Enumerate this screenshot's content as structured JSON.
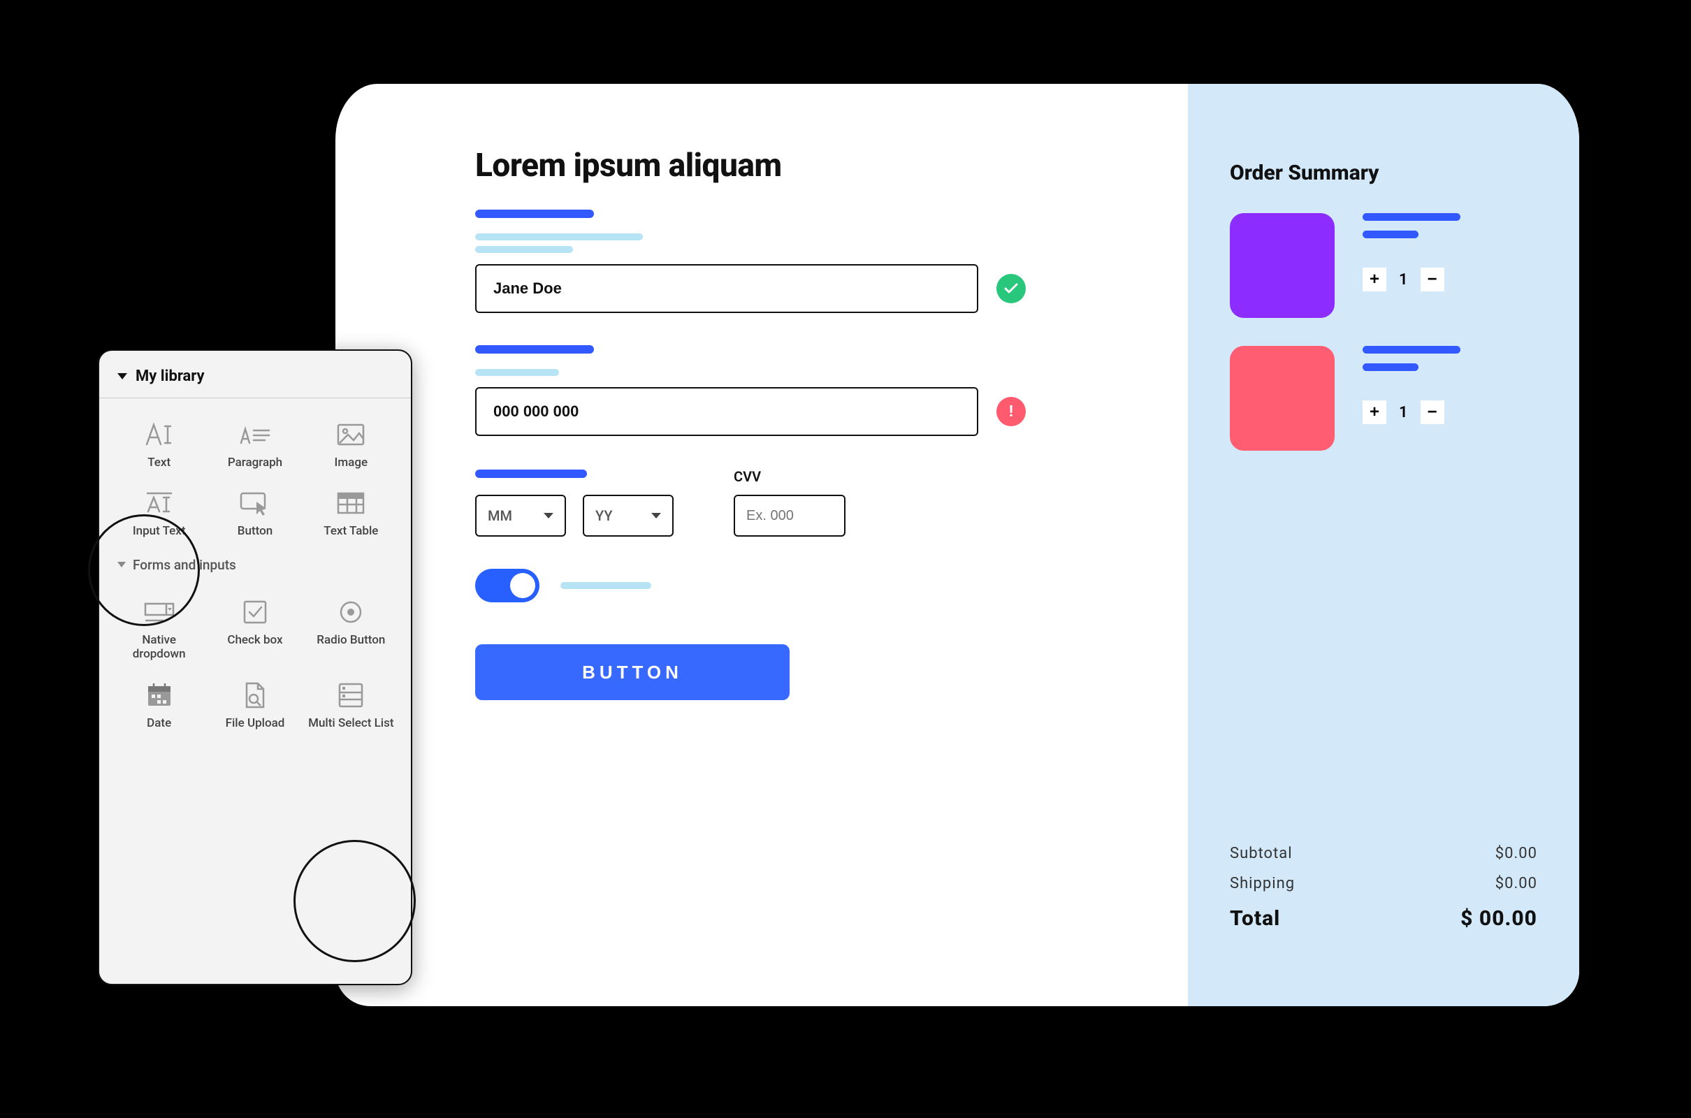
{
  "library": {
    "header": "My library",
    "items_row1": [
      {
        "label": "Text"
      },
      {
        "label": "Paragraph"
      },
      {
        "label": "Image"
      }
    ],
    "items_row2": [
      {
        "label": "Input Text"
      },
      {
        "label": "Button"
      },
      {
        "label": "Text Table"
      }
    ],
    "section2_title": "Forms and inputs",
    "items_row3": [
      {
        "label": "Native dropdown"
      },
      {
        "label": "Check box"
      },
      {
        "label": "Radio Button"
      }
    ],
    "items_row4": [
      {
        "label": "Date"
      },
      {
        "label": "File Upload"
      },
      {
        "label": "Multi Select List"
      }
    ]
  },
  "form": {
    "title": "Lorem ipsum aliquam",
    "name_value": "Jane Doe",
    "phone_value": "000 000 000",
    "exp_month_placeholder": "MM",
    "exp_year_placeholder": "YY",
    "cvv_label": "CVV",
    "cvv_placeholder": "Ex. 000",
    "submit_label": "BUTTON"
  },
  "summary": {
    "title": "Order Summary",
    "items": [
      {
        "color": "#8c2cff",
        "qty": "1"
      },
      {
        "color": "#ff5d72",
        "qty": "1"
      }
    ],
    "subtotal_label": "Subtotal",
    "subtotal_value": "$0.00",
    "shipping_label": "Shipping",
    "shipping_value": "$0.00",
    "total_label": "Total",
    "total_value": "$ 00.00"
  }
}
